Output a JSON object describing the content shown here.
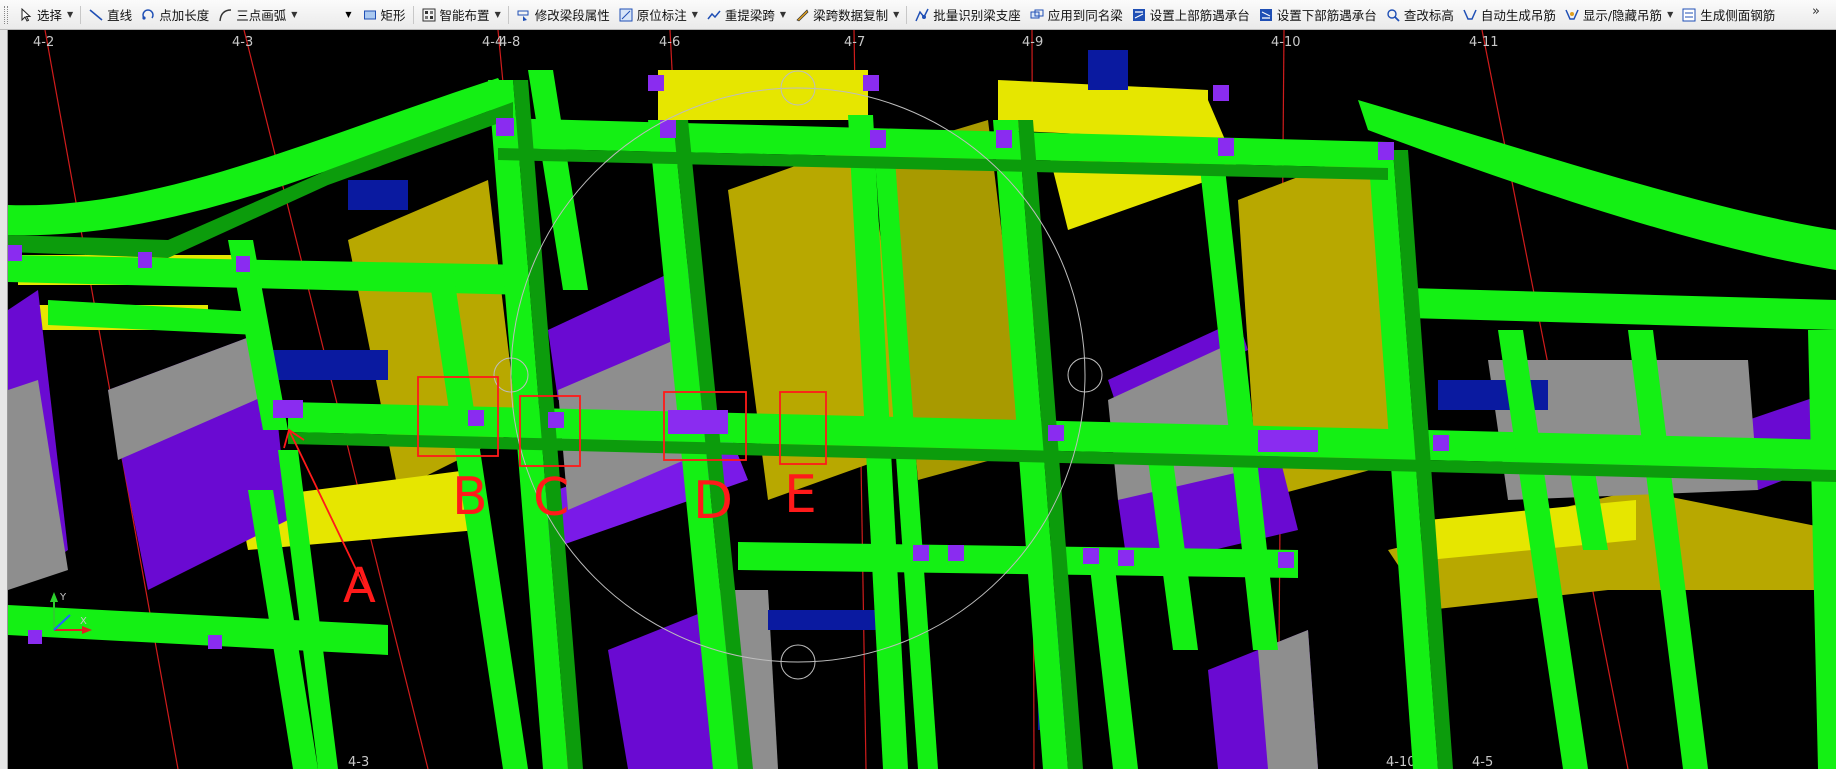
{
  "toolbar": {
    "items": [
      {
        "label": "选择",
        "icon": "select-cursor-icon",
        "dropdown": true
      },
      {
        "label": "直线",
        "icon": "line-icon",
        "dropdown": false
      },
      {
        "label": "点加长度",
        "icon": "point-length-icon",
        "dropdown": false
      },
      {
        "label": "三点画弧",
        "icon": "arc-icon",
        "dropdown": true
      },
      {
        "label": "矩形",
        "icon": "rectangle-icon",
        "dropdown": false
      },
      {
        "label": "智能布置",
        "icon": "smart-layout-icon",
        "dropdown": true
      },
      {
        "label": "修改梁段属性",
        "icon": "beam-property-icon",
        "dropdown": false
      },
      {
        "label": "原位标注",
        "icon": "in-place-label-icon",
        "dropdown": true
      },
      {
        "label": "重提梁跨",
        "icon": "respan-icon",
        "dropdown": true
      },
      {
        "label": "梁跨数据复制",
        "icon": "span-copy-icon",
        "dropdown": true
      },
      {
        "label": "批量识别梁支座",
        "icon": "batch-support-icon",
        "dropdown": false
      },
      {
        "label": "应用到同名梁",
        "icon": "apply-same-name-icon",
        "dropdown": false
      },
      {
        "label": "设置上部筋遇承台",
        "icon": "top-rebar-cap-icon",
        "dropdown": false
      },
      {
        "label": "设置下部筋遇承台",
        "icon": "bottom-rebar-cap-icon",
        "dropdown": false
      },
      {
        "label": "查改标高",
        "icon": "elevation-icon",
        "dropdown": false
      },
      {
        "label": "自动生成吊筋",
        "icon": "auto-hanger-icon",
        "dropdown": false
      },
      {
        "label": "显示/隐藏吊筋",
        "icon": "toggle-hanger-icon",
        "dropdown": true
      },
      {
        "label": "生成侧面钢筋",
        "icon": "side-rebar-icon",
        "dropdown": false
      }
    ],
    "overflow": "»"
  },
  "axes": {
    "top": [
      "4-2",
      "4-3",
      "4-4",
      "4-8",
      "4-6",
      "4-7",
      "4-9",
      "4-10",
      "4-11"
    ],
    "bottom": [
      "4-3",
      "4-10",
      "4-5"
    ]
  },
  "annotations": {
    "A": "A",
    "B": "B",
    "C": "C",
    "D": "D",
    "E": "E"
  },
  "colors": {
    "beam": "#14f014",
    "beam_dark": "#0c9c0c",
    "slab": "#b8a800",
    "slab_light": "#e6e600",
    "wall": "#6a0ad2",
    "gray": "#8e8e8e",
    "blue": "#0a1aa0",
    "annotation": "#ff1a1a",
    "axis_line": "#d01c1c",
    "bg": "#000000"
  }
}
